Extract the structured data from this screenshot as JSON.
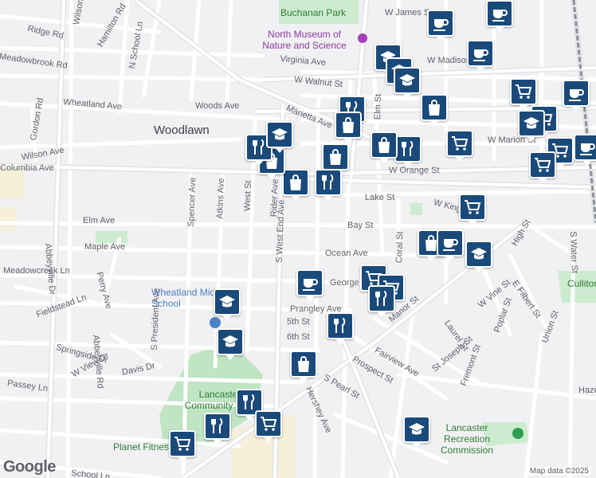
{
  "map": {
    "attribution": "Map data ©2025",
    "logo": "Google",
    "labels": {
      "woodlawn": "Woodlawn",
      "buchanan_park": "Buchanan Park",
      "north_museum": "North Museum of Nature and Science",
      "wheatland_ms": "Wheatland Middle School",
      "lancaster_park": "Lancaster Community Park",
      "planet_fitness": "Planet Fitness",
      "recreation": "Lancaster Recreation Commission",
      "culliton": "Culliton Park"
    },
    "streets": {
      "w_james": "W James St",
      "ridge_rd": "Ridge Rd",
      "meadowbrook": "Meadowbrook Rd",
      "hamilton": "Hamilton Rd",
      "n_school": "N School Ln",
      "wilson": "Wilson Dr",
      "virginia": "Virginia Ave",
      "w_walnut": "W Walnut St",
      "w_madison": "W Madison St",
      "wheatland_ave": "Wheatland Ave",
      "woods": "Woods Ave",
      "marietta": "Marietta Ave",
      "elm_st": "Elm St",
      "w_marion": "W Marion St",
      "gordon": "Gordon Rd",
      "wilson_ave": "Wilson Ave",
      "columbia": "Columbia Ave",
      "w_orange": "W Orange St",
      "lake": "Lake St",
      "w_king": "W King St",
      "elm_ave": "Elm Ave",
      "bay": "Bay St",
      "maple": "Maple Ave",
      "ocean": "Ocean Ave",
      "meadowcreek": "Meadowcreek Ln",
      "george": "George St",
      "fieldstead": "Fieldstead Ln",
      "prangley": "Prangley Ave",
      "fifth": "5th St",
      "sixth": "6th St",
      "springside": "Springside Dr",
      "davis": "Davis Dr",
      "w_view": "W View Dr",
      "passey": "Passey Ln",
      "abbeyville_dr": "Abbeyville Dr",
      "abbeyville_rd": "Abbeyville Rd",
      "perry": "Perry Ave",
      "spencer": "Spencer Ave",
      "atkins": "Atkins Ave",
      "west_st": "West St",
      "rider": "Rider Ave",
      "s_west_end": "S West End Ave",
      "coral": "Coral St",
      "manor": "Manor St",
      "laurel": "Laurel St",
      "w_vine": "W Vine St",
      "e_filbert": "E Filbert St",
      "high": "High St",
      "poplar": "Poplar St",
      "union": "Union St",
      "fremont": "Fremont St",
      "st_joseph": "St Joseph St",
      "fairview": "Fairview Ave",
      "prospect": "Prospect St",
      "s_pearl": "S Pearl St",
      "hershey": "Hershey Ave",
      "s_water": "S Water St",
      "school_ln": "School Ln",
      "hazel": "Haze",
      "s_president": "S President Ave"
    },
    "colors": {
      "coffee_pin": "#0d4f82",
      "school_pin": "#0d4f82",
      "shop_pin": "#0d4f82",
      "food_pin": "#0d4f82",
      "park": "#c8e6c9"
    }
  }
}
